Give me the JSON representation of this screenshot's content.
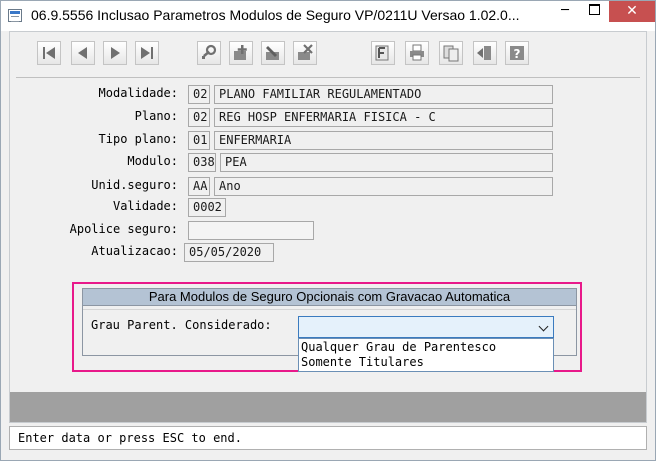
{
  "window": {
    "title": "06.9.5556  Inclusao  Parametros Modulos de Seguro VP/0211U Versao 1.02.0...",
    "minimize_glyph": "─",
    "close_glyph": "✕"
  },
  "toolbar": {
    "buttons": [
      {
        "icon": "first-record-icon"
      },
      {
        "icon": "previous-record-icon"
      },
      {
        "icon": "next-record-icon"
      },
      {
        "icon": "last-record-icon"
      },
      {
        "icon": "search-key-icon"
      },
      {
        "icon": "add-record-icon"
      },
      {
        "icon": "edit-record-icon"
      },
      {
        "icon": "delete-record-icon"
      },
      {
        "icon": "fields-icon"
      },
      {
        "icon": "print-icon"
      },
      {
        "icon": "copy-icon"
      },
      {
        "icon": "exit-icon"
      },
      {
        "icon": "help-icon"
      }
    ]
  },
  "form": {
    "modalidade": {
      "label": "Modalidade:",
      "code": "02",
      "desc": "PLANO FAMILIAR REGULAMENTADO"
    },
    "plano": {
      "label": "Plano:",
      "code": "02",
      "desc": "REG HOSP ENFERMARIA FISICA - C"
    },
    "tipo_plano": {
      "label": "Tipo plano:",
      "code": "01",
      "desc": "ENFERMARIA"
    },
    "modulo": {
      "label": "Modulo:",
      "code": "038",
      "desc": "PEA"
    },
    "unid_seguro": {
      "label": "Unid.seguro:",
      "code": "AA",
      "desc": "Ano"
    },
    "validade": {
      "label": "Validade:",
      "value": "0002"
    },
    "apolice_seguro": {
      "label": "Apolice seguro:",
      "value": ""
    },
    "atualizacao": {
      "label": "Atualizacao:",
      "value": "05/05/2020"
    }
  },
  "panel": {
    "title": "Para Modulos de Seguro Opcionais com Gravacao Automatica",
    "grau_label": "Grau Parent. Considerado:",
    "combo_value": "",
    "options": [
      "Qualquer Grau de Parentesco",
      "Somente Titulares"
    ]
  },
  "status": {
    "text": "Enter data or press ESC to end."
  },
  "colors": {
    "highlight": "#e8198a",
    "panel_header": "#b4c3d4",
    "close_button": "#c75050"
  }
}
